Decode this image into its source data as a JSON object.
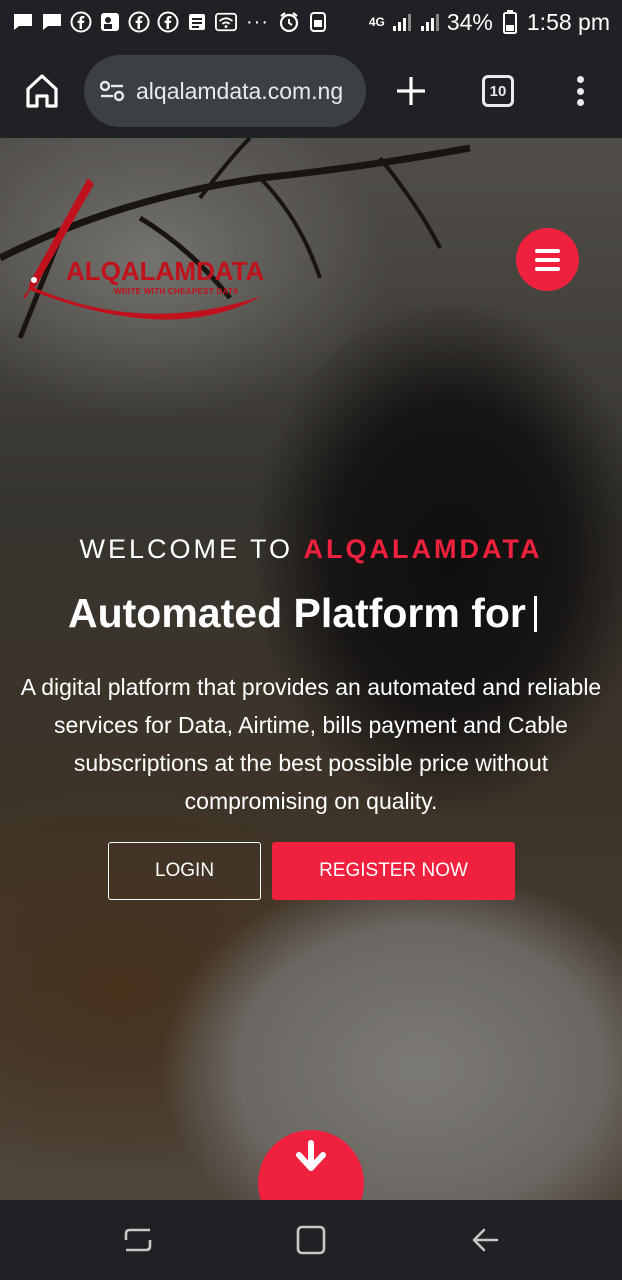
{
  "status_bar": {
    "icons": [
      "message-icon",
      "message-icon",
      "facebook-icon",
      "app-icon",
      "facebook-icon",
      "facebook-icon",
      "notes-icon",
      "wifi-icon",
      "more-dots-icon",
      "alarm-icon",
      "sim-icon",
      "lte-icon",
      "signal-icon",
      "signal-icon",
      "battery-icon"
    ],
    "network": "4G",
    "battery": "34%",
    "time": "1:58 pm"
  },
  "browser": {
    "url": "alqalamdata.com.ng",
    "tab_count": "10"
  },
  "logo": {
    "name": "ALQALAMDATA",
    "tagline": "WRITE WITH CHEAPEST DATA"
  },
  "hero": {
    "welcome_prefix": "WELCOME TO",
    "welcome_brand": "ALQALAMDATA",
    "headline": "Automated Platform for",
    "description": "A digital platform that provides an automated and reliable services for Data, Airtime, bills payment and Cable subscriptions at the best possible price without compromising on quality.",
    "login_label": "LOGIN",
    "register_label": "REGISTER NOW"
  },
  "colors": {
    "accent": "#f0213f",
    "logo_red": "#c0111c",
    "chrome_bg": "#202124"
  }
}
